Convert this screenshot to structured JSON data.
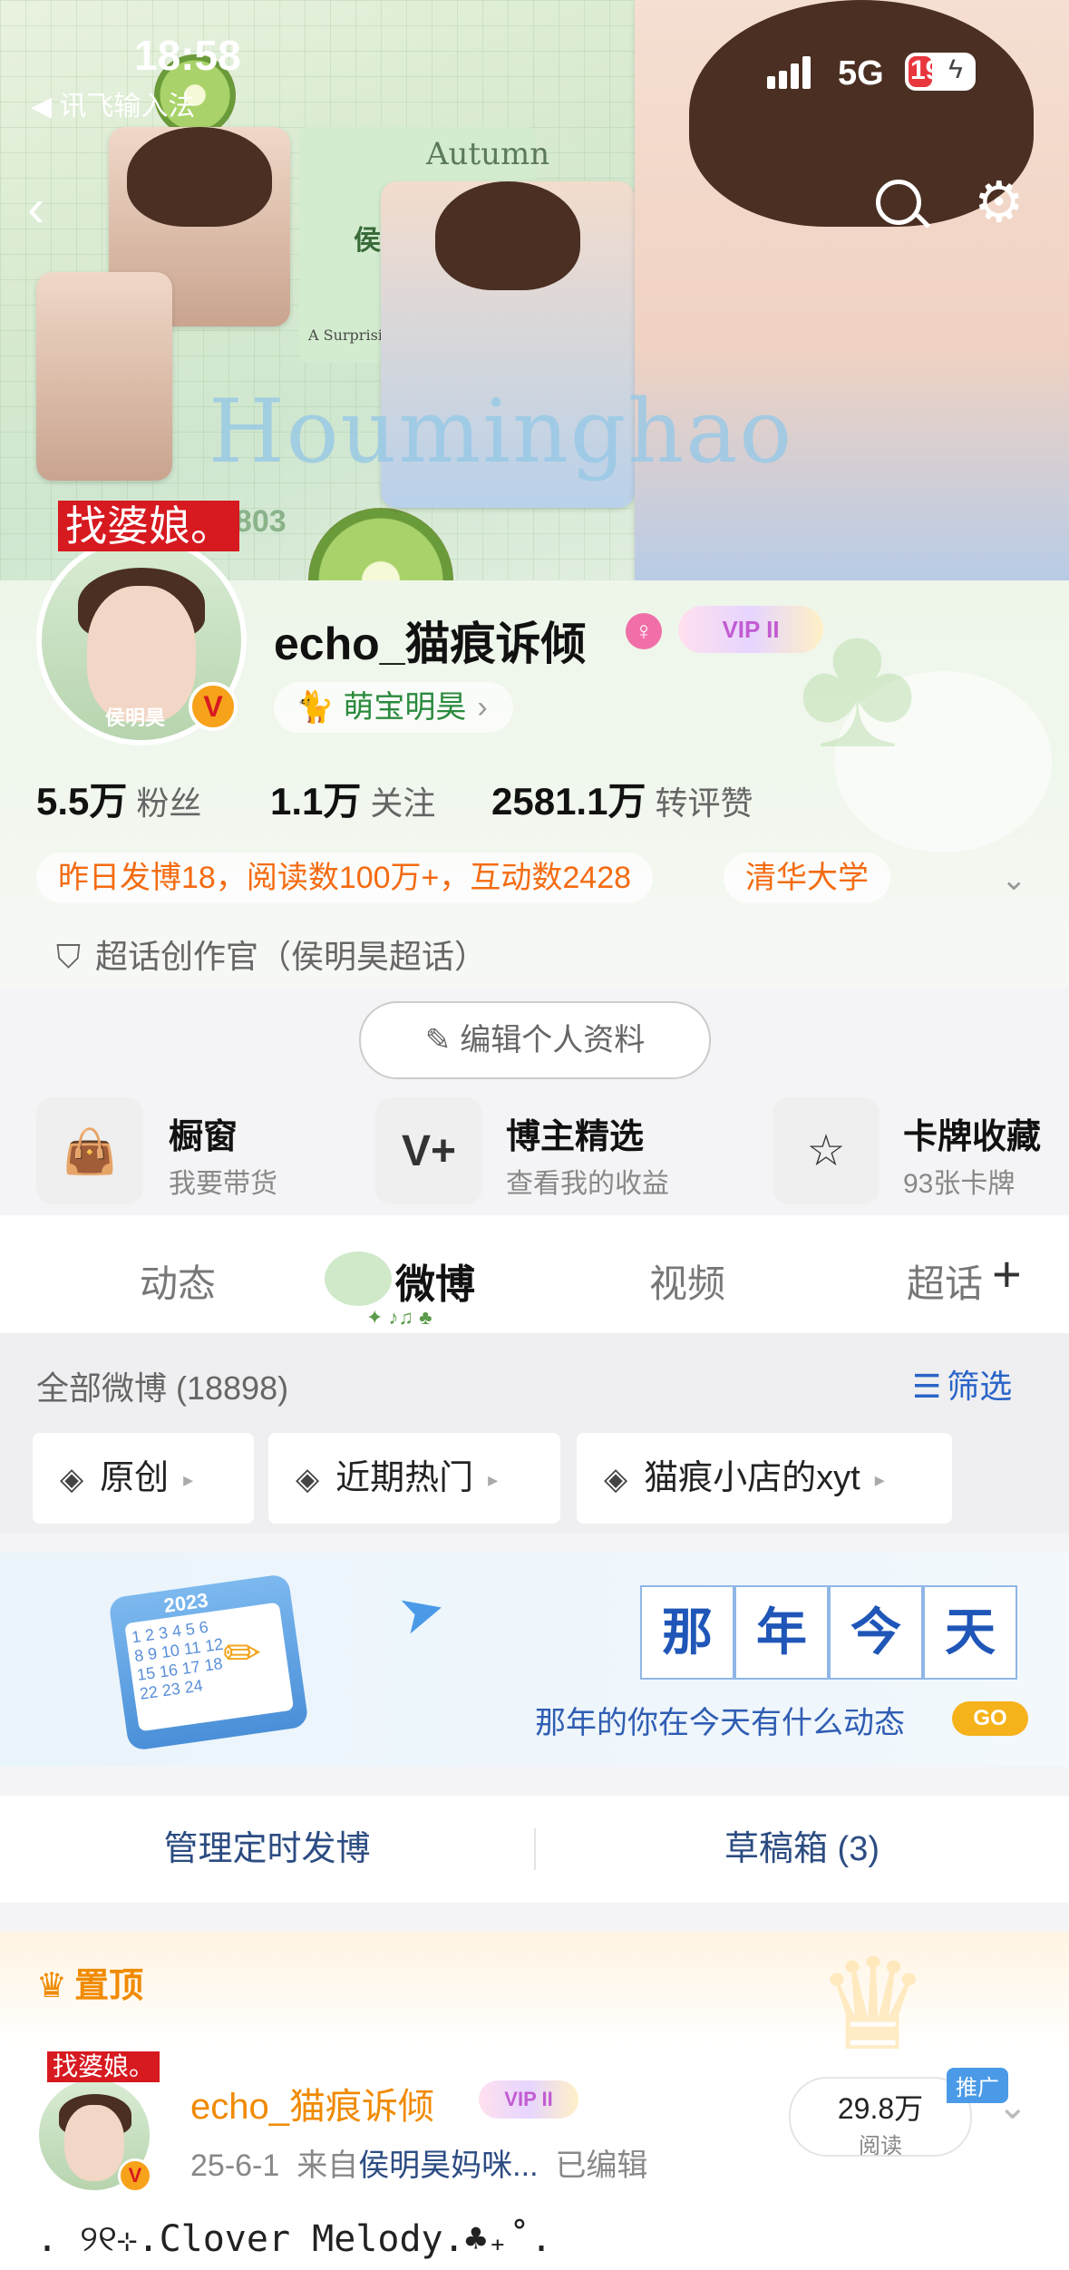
{
  "status_bar": {
    "time": "18:58",
    "back_app": "◀ 讯飞输入法",
    "network": "5G",
    "battery": "19"
  },
  "banner": {
    "background_text": "Houminghao",
    "tag": "找婆娘。",
    "label_name": "侯明昊",
    "label_autumn": "Autumn",
    "label_encounter": "A Surprising Encounter",
    "label_number": "0803"
  },
  "profile": {
    "avatar_label": "侯明昊",
    "username": "echo_猫痕诉倾",
    "vip_label": "VIP II",
    "fan_club": "萌宝明昊",
    "stats": [
      {
        "value": "5.5万",
        "label": "粉丝"
      },
      {
        "value": "1.1万",
        "label": "关注"
      },
      {
        "value": "2581.1万",
        "label": "转评赞"
      }
    ],
    "summary": "昨日发博18，阅读数100万+，互动数2428",
    "school": "清华大学",
    "title": "超话创作官（侯明昊超话）",
    "edit_button": "编辑个人资料"
  },
  "features": [
    {
      "title": "橱窗",
      "subtitle": "我要带货",
      "icon": "shopping-bag-icon"
    },
    {
      "title": "博主精选",
      "subtitle": "查看我的收益",
      "icon": "v-plus-icon"
    },
    {
      "title": "卡牌收藏",
      "subtitle": "93张卡牌",
      "icon": "card-star-icon"
    }
  ],
  "tabs": [
    {
      "label": "动态"
    },
    {
      "label": "微博",
      "active": true
    },
    {
      "label": "视频"
    },
    {
      "label": "超话"
    }
  ],
  "feed": {
    "count_label": "全部微博 (18898)",
    "filter_label": "筛选",
    "chips": [
      "原创",
      "近期热门",
      "猫痕小店的xyt"
    ]
  },
  "on_this_day": {
    "year": "2023",
    "title_chars": [
      "那",
      "年",
      "今",
      "天"
    ],
    "text": "那年的你在今天有什么动态",
    "go": "GO"
  },
  "manage": {
    "scheduled": "管理定时发博",
    "drafts": "草稿箱 (3)"
  },
  "pinned": {
    "label": "置顶",
    "tag": "找婆娘。",
    "username": "echo_猫痕诉倾",
    "vip_label": "VIP II",
    "date": "25-6-1",
    "source_prefix": "来自",
    "source": "侯明昊妈咪...",
    "edited": "已编辑",
    "reads_value": "29.8万",
    "reads_label": "阅读",
    "promo": "推广",
    "body": ". ୨୧⊹.Clover Melody.♣₊˚."
  },
  "colors": {
    "accent_orange": "#f08a00",
    "link_blue": "#2a64c8",
    "vip_badge": "#f7a21b",
    "red_tag": "#d71920"
  }
}
